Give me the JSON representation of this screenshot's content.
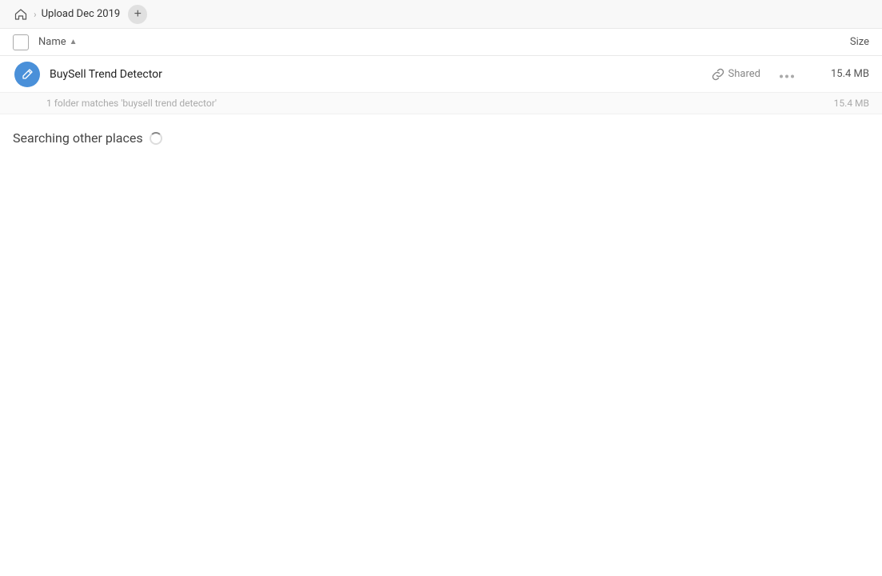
{
  "topbar": {
    "home_icon": "home",
    "chevron": "›",
    "breadcrumb_label": "Upload Dec 2019",
    "add_button_label": "+"
  },
  "columns": {
    "name_label": "Name",
    "sort_indicator": "▲",
    "size_label": "Size"
  },
  "file_row": {
    "name": "BuySell Trend Detector",
    "shared_label": "Shared",
    "more_icon": "•••",
    "size": "15.4 MB"
  },
  "match_info": {
    "text": "1 folder matches 'buysell trend detector'",
    "size": "15.4 MB"
  },
  "searching": {
    "label": "Searching other places"
  }
}
